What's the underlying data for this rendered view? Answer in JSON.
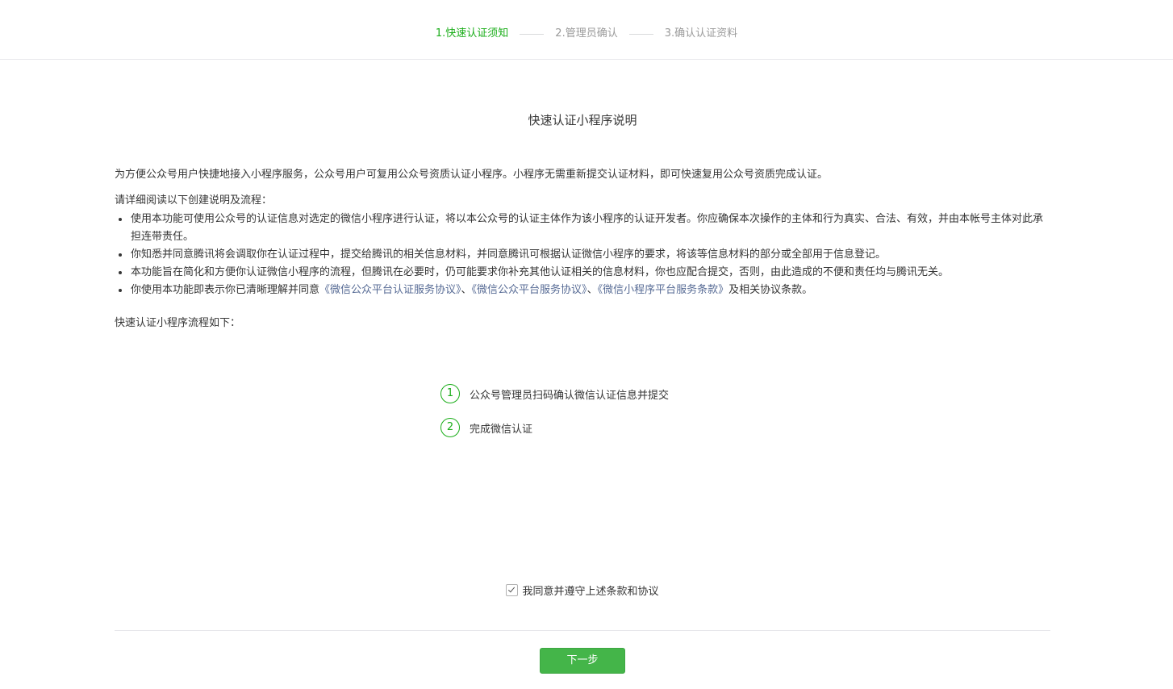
{
  "steps": [
    {
      "label": "1.快速认证须知",
      "active": true
    },
    {
      "label": "2.管理员确认",
      "active": false
    },
    {
      "label": "3.确认认证资料",
      "active": false
    }
  ],
  "title": "快速认证小程序说明",
  "intro": "为方便公众号用户快捷地接入小程序服务，公众号用户可复用公众号资质认证小程序。小程序无需重新提交认证材料，即可快速复用公众号资质完成认证。",
  "read_title": "请详细阅读以下创建说明及流程：",
  "rules": {
    "r1": "使用本功能可使用公众号的认证信息对选定的微信小程序进行认证，将以本公众号的认证主体作为该小程序的认证开发者。你应确保本次操作的主体和行为真实、合法、有效，并由本帐号主体对此承担连带责任。",
    "r2": "你知悉并同意腾讯将会调取你在认证过程中，提交给腾讯的相关信息材料，并同意腾讯可根据认证微信小程序的要求，将该等信息材料的部分或全部用于信息登记。",
    "r3": "本功能旨在简化和方便你认证微信小程序的流程，但腾讯在必要时，仍可能要求你补充其他认证相关的信息材料，你也应配合提交，否则，由此造成的不便和责任均与腾讯无关。",
    "r4_prefix": "你使用本功能即表示你已清晰理解并同意",
    "r4_link1": "《微信公众平台认证服务协议》",
    "r4_sep1": "、",
    "r4_link2": "《微信公众平台服务协议》",
    "r4_sep2": "、",
    "r4_link3": "《微信小程序平台服务条款》",
    "r4_suffix": "及相关协议条款。"
  },
  "flow_title": "快速认证小程序流程如下：",
  "flow": [
    {
      "num": "1",
      "text": "公众号管理员扫码确认微信认证信息并提交"
    },
    {
      "num": "2",
      "text": "完成微信认证"
    }
  ],
  "agree_label": "我同意并遵守上述条款和协议",
  "agree_checked": true,
  "next_label": "下一步",
  "colors": {
    "accent": "#1aad19",
    "button": "#44b549",
    "link": "#576b95"
  }
}
